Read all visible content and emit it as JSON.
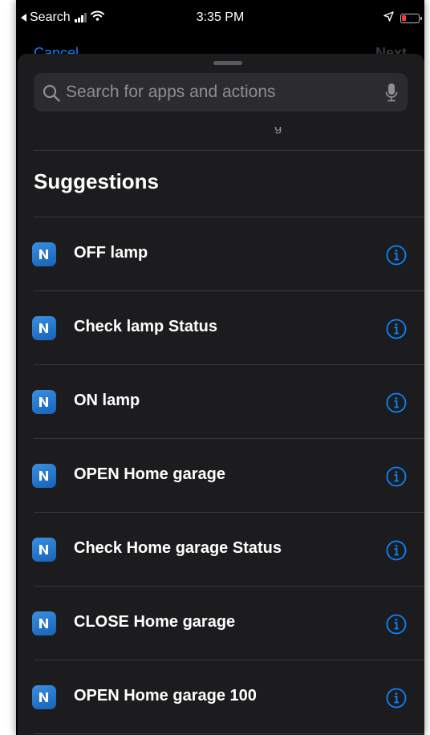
{
  "status_bar": {
    "back_label": "Search",
    "time": "3:35 PM",
    "battery_color": "#ff3b30"
  },
  "behind": {
    "cancel_label": "Cancel",
    "next_label": "Next"
  },
  "search": {
    "placeholder": "Search for apps and actions",
    "value": ""
  },
  "section": {
    "title": "Suggestions"
  },
  "suggestions": [
    {
      "label": "OFF lamp",
      "icon": "app-n-icon"
    },
    {
      "label": "Check lamp Status",
      "icon": "app-n-icon"
    },
    {
      "label": "ON lamp",
      "icon": "app-n-icon"
    },
    {
      "label": "OPEN Home garage",
      "icon": "app-n-icon"
    },
    {
      "label": "Check Home garage Status",
      "icon": "app-n-icon"
    },
    {
      "label": "CLOSE Home garage",
      "icon": "app-n-icon"
    },
    {
      "label": "OPEN Home garage 100",
      "icon": "app-n-icon"
    }
  ],
  "colors": {
    "accent": "#0a84ff",
    "sheet_background": "#1c1c1e",
    "app_icon": "#2a7bd4"
  }
}
